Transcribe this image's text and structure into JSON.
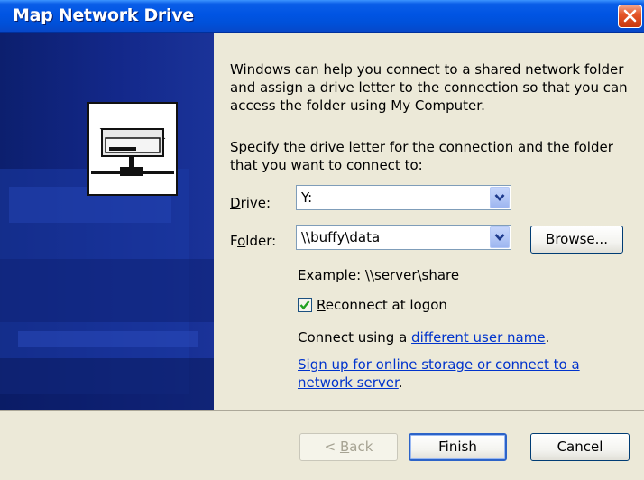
{
  "window": {
    "title": "Map Network Drive"
  },
  "intro": {
    "line1": "Windows can help you connect to a shared network folder",
    "line2": "and assign a drive letter to the connection so that you can",
    "line3": "access the folder using My Computer."
  },
  "specify": {
    "line1": "Specify the drive letter for the connection and the folder",
    "line2": "that you want to connect to:"
  },
  "drive": {
    "label_pre": "",
    "label_acc": "D",
    "label_post": "rive:",
    "value": "Y:"
  },
  "folder": {
    "label_pre": "F",
    "label_acc": "o",
    "label_post": "lder:",
    "value": "\\\\buffy\\data"
  },
  "browse": {
    "label_acc": "B",
    "label_post": "rowse..."
  },
  "example_text": "Example: \\\\server\\share",
  "reconnect": {
    "checked": true,
    "label_acc": "R",
    "label_post": "econnect at logon"
  },
  "connect_using": {
    "prefix": "Connect using a ",
    "link": "different user name",
    "suffix": "."
  },
  "signup": {
    "line1": "Sign up for online storage or connect to a",
    "line2": "network server",
    "suffix": "."
  },
  "buttons": {
    "back_pre": "< ",
    "back_acc": "B",
    "back_post": "ack",
    "finish": "Finish",
    "cancel": "Cancel"
  },
  "icons": [
    "close-icon",
    "network-drive-icon",
    "dropdown-arrow-icon",
    "checkmark-icon"
  ],
  "colors": {
    "titlebar": "#0054e3",
    "side_panel": "#13288a",
    "dialog_bg": "#ece9d8",
    "link": "#0033cc"
  }
}
